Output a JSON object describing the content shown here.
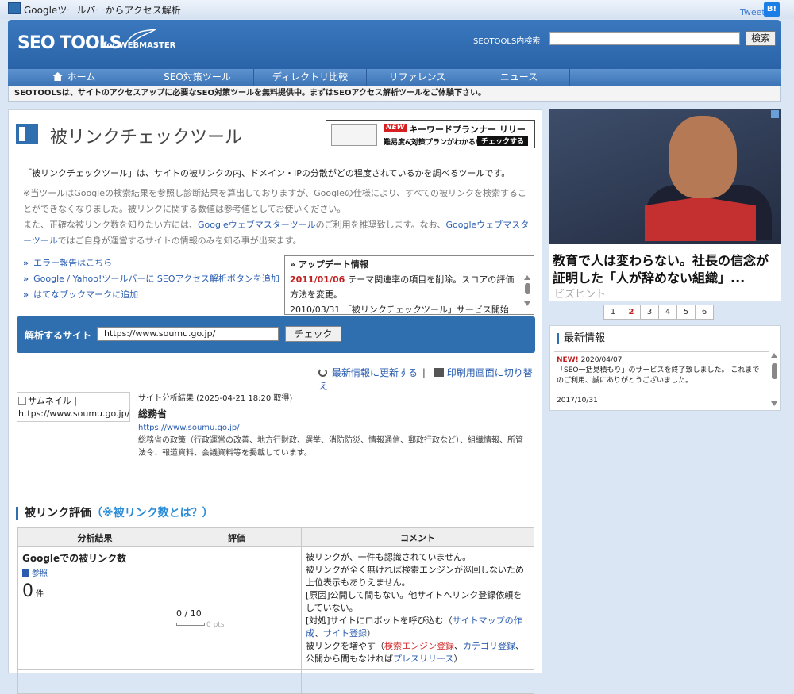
{
  "topbar": {
    "title": "Googleツールバーからアクセス解析",
    "tweet": "Tweet",
    "hatena": "B!"
  },
  "header": {
    "logo_main": "SEO TOOLS",
    "logo_sub": "for WEBMASTER",
    "search_label": "SEOTOOLS内検索",
    "search_value": "",
    "search_button": "検索"
  },
  "nav": {
    "items": [
      {
        "label": "ホーム",
        "icon": "home-icon"
      },
      {
        "label": "SEO対策ツール"
      },
      {
        "label": "ディレクトリ比較"
      },
      {
        "label": "リファレンス"
      },
      {
        "label": "ニュース"
      }
    ]
  },
  "notice": "SEOTOOLSは、サイトのアクセスアップに必要なSEO対策ツールを無料提供中。まずはSEOアクセス解析ツールをご体験下さい。",
  "page": {
    "title": "被リンクチェックツール",
    "intro": "「被リンクチェックツール」は、サイトの被リンクの内、ドメイン・IPの分散がどの程度されているかを調べるツールです。",
    "note1": "※当ツールはGoogleの検索結果を参照し診断結果を算出しておりますが、Googleの仕様により、すべての被リンクを検索することができなくなりました。被リンクに関する数値は参考値としてお使いください。",
    "note2_pre": "また、正確な被リンク数を知りたい方には、",
    "note2_link": "Googleウェブマスターツール",
    "note2_mid": "のご利用を推奨致します。なお、",
    "note2_link2": "Googleウェブマスターツール",
    "note2_post": "ではご自身が運営するサイトの情報のみを知る事が出来ます。"
  },
  "banner": {
    "new": "NEW",
    "headline": "キーワードプランナー リリース!",
    "sub": "難易度&対策プランがわかる!",
    "check": "チェックする"
  },
  "links": [
    "エラー報告はこちら",
    "Google / Yahoo!ツールバーに SEOアクセス解析ボタンを追加",
    "はてなブックマークに追加"
  ],
  "update": {
    "header": "アップデート情報",
    "date1": "2011/01/06",
    "text1": "テーマ関連率の項目を削除。スコアの評価方法を変更。",
    "date2": "2010/03/31",
    "text2": "「被リンクチェックツール」サービス開始"
  },
  "analyze": {
    "label": "解析するサイト",
    "url": "https://www.soumu.go.jp/",
    "button": "チェック"
  },
  "actions": {
    "refresh": "最新情報に更新する",
    "separator": "|",
    "print": "印刷用画面に切り替え"
  },
  "result": {
    "thumb_alt": "サムネイル",
    "thumb_url": "https://www.soumu.go.jp/",
    "meta": "サイト分析結果 (2025-04-21 18:20 取得)",
    "site_name": "総務省",
    "url": "https://www.soumu.go.jp/",
    "description": "総務省の政策（行政運営の改善、地方行財政、選挙、消防防災、情報通信、郵政行政など）、組織情報、所管法令、報道資料、会議資料等を掲載しています。"
  },
  "section": {
    "title": "被リンク評価",
    "link": "（※被リンク数とは？）"
  },
  "table": {
    "headers": [
      "分析結果",
      "評価",
      "コメント"
    ],
    "row1": {
      "name": "Googleでの被リンク数",
      "ref": "参照",
      "count": "0",
      "unit": "件",
      "score": "0 / 10",
      "score_fraction": 0,
      "pts": "0 pts",
      "c1": "被リンクが、一件も認識されていません。",
      "c2": "被リンクが全く無ければ検索エンジンが巡回しないため上位表示もありえません。",
      "c3": "[原因]公開して間もない。他サイトへリンク登録依頼をしていない。",
      "c4_pre": "[対処]サイトにロボットを呼び込む（",
      "c4_link1": "サイトマップの作成",
      "c4_sep": "、",
      "c4_link2": "サイト登録",
      "c4_post": "）",
      "c5_pre": "被リンクを増やす（",
      "c5_link1": "検索エンジン登録",
      "c5_sep1": "、",
      "c5_link2": "カテゴリ登録",
      "c5_mid": "、公開から間もなければ",
      "c5_link3": "プレスリリース",
      "c5_post": "）"
    }
  },
  "ad": {
    "caption": "教育で人は変わらない。社長の信念が証明した「人が辞めない組織」...",
    "source": "ビズヒント"
  },
  "pager": {
    "pages": [
      "1",
      "2",
      "3",
      "4",
      "5",
      "6"
    ],
    "current": "2"
  },
  "news": {
    "header": "最新情報",
    "new_badge": "NEW!",
    "date1": "2020/04/07",
    "text1": "「SEO一括見積もり」のサービスを終了致しました。 これまでのご利用、誠にありがとうございました。",
    "date2": "2017/10/31"
  },
  "colors": {
    "brand_blue": "#2f6fb0",
    "nav_blue": "#4a83c4",
    "accent_red": "#c0201f",
    "link_blue": "#2a5db0"
  }
}
